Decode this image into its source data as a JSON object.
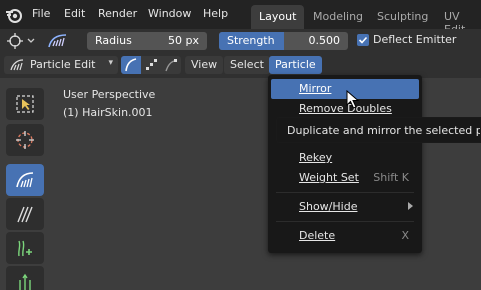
{
  "menubar": {
    "items": [
      "File",
      "Edit",
      "Render",
      "Window",
      "Help"
    ],
    "workspaces": [
      "Layout",
      "Modeling",
      "Sculpting",
      "UV Edit"
    ],
    "active_workspace": "Layout"
  },
  "tool_settings": {
    "radius": {
      "label": "Radius",
      "value": "50 px"
    },
    "strength": {
      "label": "Strength",
      "value": "0.500",
      "fill_fraction": 0.5
    },
    "deflect_emitter": {
      "label": "Deflect Emitter",
      "checked": true
    }
  },
  "header": {
    "mode": "Particle Edit",
    "menus": [
      "View",
      "Select",
      "Particle"
    ],
    "active_menu": "Particle"
  },
  "viewport": {
    "perspective": "User Perspective",
    "object": "(1) HairSkin.001"
  },
  "particle_menu": {
    "items": [
      {
        "label": "Mirror",
        "shortcut": "",
        "highlighted": true
      },
      {
        "label": "Remove Doubles",
        "shortcut": ""
      },
      {
        "label": "Rekey",
        "shortcut": ""
      },
      {
        "label": "Weight Set",
        "shortcut": "Shift K"
      },
      {
        "label": "Show/Hide",
        "shortcut": "",
        "submenu": true
      },
      {
        "label": "Delete",
        "shortcut": "X"
      }
    ]
  },
  "tooltip": {
    "text": "Duplicate and mirror the selected partic"
  },
  "colors": {
    "accent": "#4772b3",
    "menubar": "#232323",
    "viewport": "#3d3d3d",
    "menu_bg": "#181818"
  }
}
